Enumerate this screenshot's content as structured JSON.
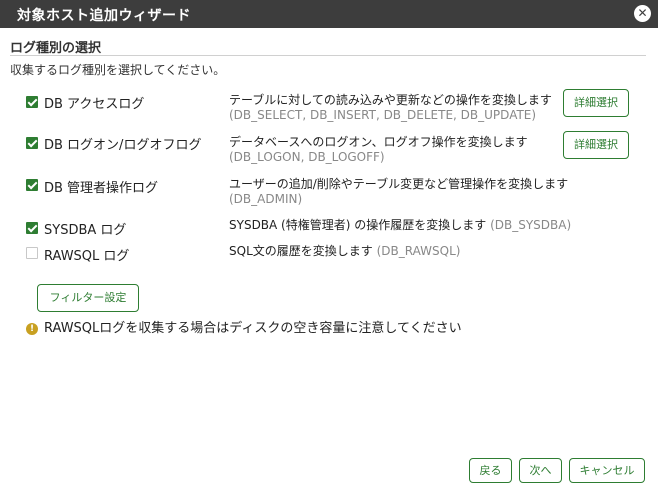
{
  "window": {
    "title": "対象ホスト追加ウィザード",
    "close_icon": "close-icon"
  },
  "section": {
    "title": "ログ種別の選択",
    "description": "収集するログ種別を選択してください。"
  },
  "log_types": [
    {
      "label": "DB アクセスログ",
      "checked": true,
      "description": "テーブルに対しての読み込みや更新などの操作を変換します",
      "codes": "(DB_SELECT, DB_INSERT, DB_DELETE, DB_UPDATE)",
      "detail_button": "詳細選択"
    },
    {
      "label": "DB ログオン/ログオフログ",
      "checked": true,
      "description": "データベースへのログオン、ログオフ操作を変換します",
      "codes": "(DB_LOGON, DB_LOGOFF)",
      "detail_button": "詳細選択"
    },
    {
      "label": "DB 管理者操作ログ",
      "checked": true,
      "description": "ユーザーの追加/削除やテーブル変更など管理操作を変換します",
      "codes": "(DB_ADMIN)"
    },
    {
      "label": "SYSDBA ログ",
      "checked": true,
      "description": "SYSDBA (特権管理者) の操作履歴を変換します",
      "codes": "(DB_SYSDBA)"
    },
    {
      "label": "RAWSQL ログ",
      "checked": false,
      "description": "SQL文の履歴を変換します",
      "codes": "(DB_RAWSQL)"
    }
  ],
  "filter_button": "フィルター設定",
  "warning": {
    "icon": "warning-icon",
    "text": "RAWSQLログを収集する場合はディスクの空き容量に注意してください"
  },
  "footer": {
    "back": "戻る",
    "next": "次へ",
    "cancel": "キャンセル"
  },
  "colors": {
    "titlebar": "#3d3d3d",
    "accent": "#2e7d32",
    "warning": "#c8a021"
  }
}
